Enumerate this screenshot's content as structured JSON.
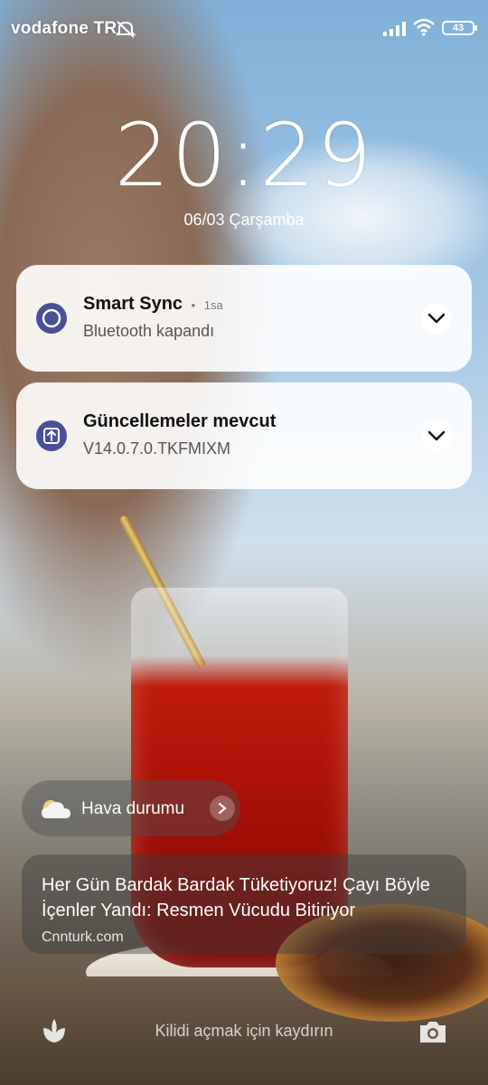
{
  "status_bar": {
    "carrier": "vodafone TR",
    "battery_level": "43",
    "icons": [
      "mute-icon",
      "signal-icon",
      "wifi-icon",
      "battery-icon"
    ]
  },
  "lockscreen": {
    "time": "20:29",
    "date": "06/03 Çarşamba"
  },
  "notifications": [
    {
      "app": "Smart Sync",
      "time": "1sa",
      "body": "Bluetooth kapandı",
      "icon": "smart-sync-icon"
    },
    {
      "app": "Güncellemeler mevcut",
      "body": "V14.0.7.0.TKFMIXM",
      "icon": "update-icon"
    }
  ],
  "weather": {
    "label": "Hava durumu",
    "icon": "cloud-icon"
  },
  "news": {
    "headline": "Her Gün Bardak Bardak Tüketiyoruz! Çayı Böyle İçenler Yandı: Resmen Vücudu Bitiriyor",
    "source": "Cnnturk.com"
  },
  "footer": {
    "unlock_hint": "Kilidi açmak için kaydırın",
    "left_icon": "tulip-icon",
    "right_icon": "camera-icon"
  },
  "colors": {
    "notification_icon": "#4a4f9a",
    "card_bg": "#ffffff"
  }
}
